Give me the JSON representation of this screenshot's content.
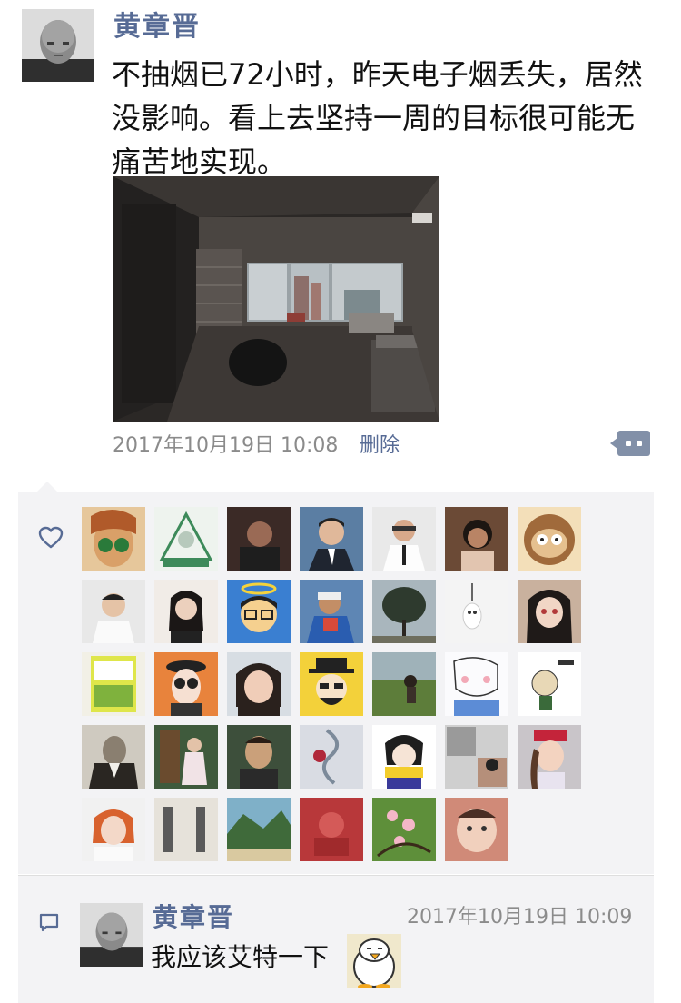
{
  "post": {
    "author": "黄章晋",
    "text": "不抽烟已72小时，昨天电子烟丢失，居然没影响。看上去坚持一周的目标很可能无痛苦地实现。",
    "timestamp": "2017年10月19日 10:08",
    "delete_label": "删除"
  },
  "icons": {
    "more": "more-icon",
    "like": "heart-icon",
    "comment": "comment-icon"
  },
  "colors": {
    "name_link": "#576b95",
    "panel_bg": "#f3f3f5",
    "meta_text": "#8b8b8b"
  },
  "likes": {
    "count": 33
  },
  "comment": {
    "author": "黄章晋",
    "timestamp": "2017年10月19日 10:09",
    "text": "我应该艾特一下"
  }
}
